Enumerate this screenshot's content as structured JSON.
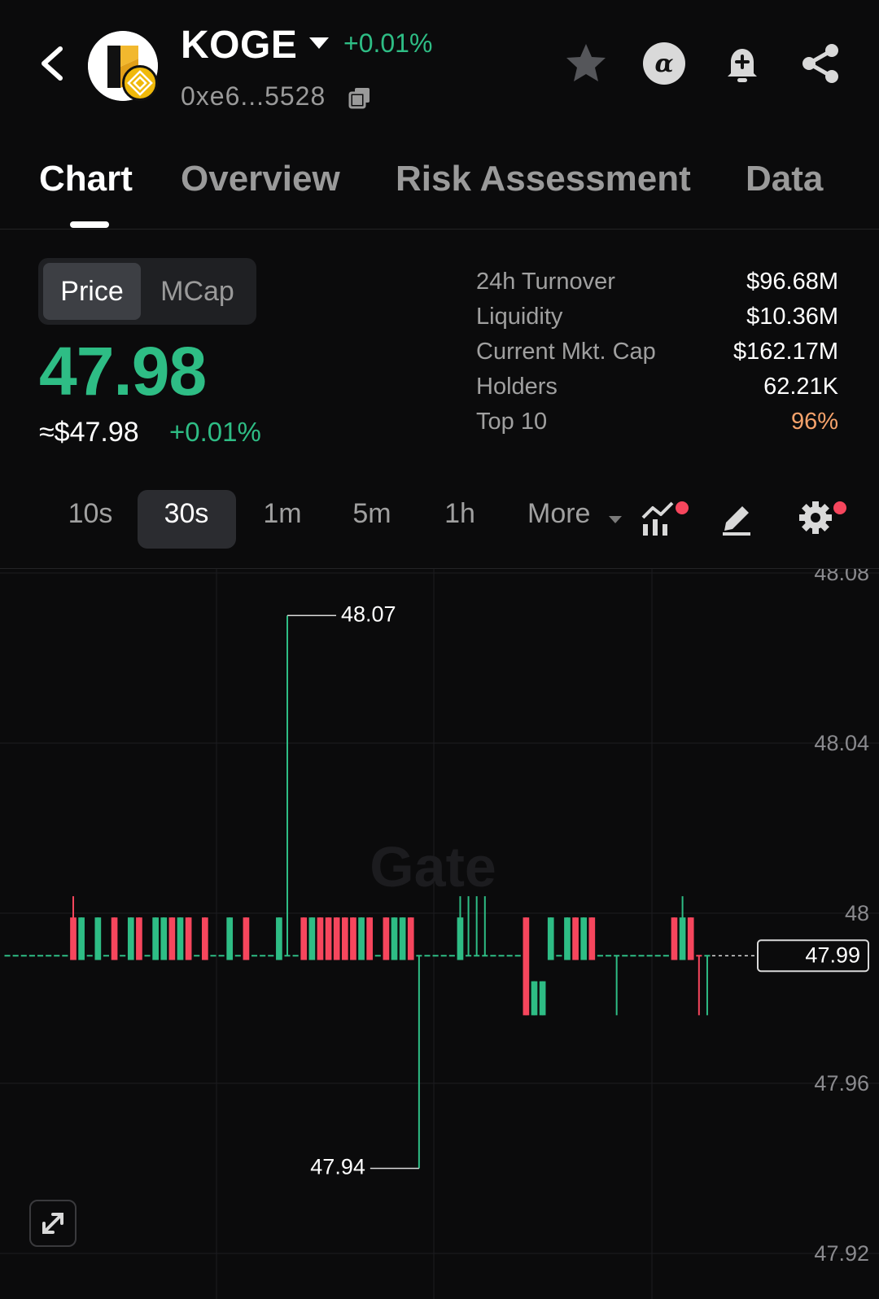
{
  "header": {
    "symbol": "KOGE",
    "change": "+0.01%",
    "address": "0xe6...5528",
    "icons": [
      "back-icon",
      "star-icon",
      "alpha-icon",
      "bell-plus-icon",
      "share-icon",
      "copy-icon"
    ]
  },
  "tabs": [
    {
      "label": "Chart",
      "active": true
    },
    {
      "label": "Overview",
      "active": false
    },
    {
      "label": "Risk Assessment",
      "active": false
    },
    {
      "label": "Data",
      "active": false
    }
  ],
  "price_panel": {
    "toggle": [
      "Price",
      "MCap"
    ],
    "selected_toggle": "Price",
    "price": "47.98",
    "usd_price": "≈$47.98",
    "change": "+0.01%",
    "stats": [
      {
        "label": "24h Turnover",
        "value": "$96.68M"
      },
      {
        "label": "Liquidity",
        "value": "$10.36M"
      },
      {
        "label": "Current Mkt. Cap",
        "value": "$162.17M"
      },
      {
        "label": "Holders",
        "value": "62.21K"
      },
      {
        "label": "Top 10",
        "value": "96%"
      }
    ]
  },
  "intervals": {
    "options": [
      "10s",
      "30s",
      "1m",
      "5m",
      "1h"
    ],
    "selected": "30s",
    "more_label": "More"
  },
  "colors": {
    "up": "#2ebd85",
    "down": "#f6465d",
    "warn": "#f5a26b",
    "background": "#0b0b0c"
  },
  "chart_data": {
    "type": "candlestick",
    "watermark": "Gate",
    "y_ticks": [
      "48.08",
      "48.04",
      "48",
      "47.96",
      "47.92"
    ],
    "ylim": [
      47.92,
      48.08
    ],
    "current_price_label": "47.99",
    "high_label": "48.07",
    "low_label": "47.94",
    "candles": [
      {
        "o": 47.99,
        "h": 47.99,
        "l": 47.99,
        "c": 47.99,
        "d": "up"
      },
      {
        "o": 47.99,
        "h": 47.99,
        "l": 47.99,
        "c": 47.99,
        "d": "up"
      },
      {
        "o": 47.99,
        "h": 47.99,
        "l": 47.99,
        "c": 47.99,
        "d": "up"
      },
      {
        "o": 47.99,
        "h": 47.99,
        "l": 47.99,
        "c": 47.99,
        "d": "up"
      },
      {
        "o": 47.99,
        "h": 47.99,
        "l": 47.99,
        "c": 47.99,
        "d": "up"
      },
      {
        "o": 47.99,
        "h": 47.99,
        "l": 47.99,
        "c": 47.99,
        "d": "up"
      },
      {
        "o": 47.99,
        "h": 47.99,
        "l": 47.99,
        "c": 47.99,
        "d": "up"
      },
      {
        "o": 47.99,
        "h": 47.99,
        "l": 47.99,
        "c": 47.99,
        "d": "up"
      },
      {
        "o": 47.999,
        "h": 48.004,
        "l": 47.989,
        "c": 47.989,
        "d": "down"
      },
      {
        "o": 47.989,
        "h": 47.999,
        "l": 47.989,
        "c": 47.999,
        "d": "up"
      },
      {
        "o": 47.99,
        "h": 47.99,
        "l": 47.99,
        "c": 47.99,
        "d": "up"
      },
      {
        "o": 47.989,
        "h": 47.999,
        "l": 47.989,
        "c": 47.999,
        "d": "up"
      },
      {
        "o": 47.99,
        "h": 47.99,
        "l": 47.99,
        "c": 47.99,
        "d": "up"
      },
      {
        "o": 47.999,
        "h": 47.999,
        "l": 47.989,
        "c": 47.989,
        "d": "down"
      },
      {
        "o": 47.99,
        "h": 47.99,
        "l": 47.99,
        "c": 47.99,
        "d": "up"
      },
      {
        "o": 47.989,
        "h": 47.999,
        "l": 47.989,
        "c": 47.999,
        "d": "up"
      },
      {
        "o": 47.999,
        "h": 47.999,
        "l": 47.989,
        "c": 47.989,
        "d": "down"
      },
      {
        "o": 47.99,
        "h": 47.99,
        "l": 47.99,
        "c": 47.99,
        "d": "up"
      },
      {
        "o": 47.989,
        "h": 47.999,
        "l": 47.989,
        "c": 47.999,
        "d": "up"
      },
      {
        "o": 47.989,
        "h": 47.999,
        "l": 47.989,
        "c": 47.999,
        "d": "up"
      },
      {
        "o": 47.999,
        "h": 47.999,
        "l": 47.989,
        "c": 47.989,
        "d": "down"
      },
      {
        "o": 47.989,
        "h": 47.999,
        "l": 47.989,
        "c": 47.999,
        "d": "up"
      },
      {
        "o": 47.999,
        "h": 47.999,
        "l": 47.989,
        "c": 47.989,
        "d": "down"
      },
      {
        "o": 47.99,
        "h": 47.99,
        "l": 47.99,
        "c": 47.99,
        "d": "up"
      },
      {
        "o": 47.999,
        "h": 47.999,
        "l": 47.989,
        "c": 47.989,
        "d": "down"
      },
      {
        "o": 47.99,
        "h": 47.99,
        "l": 47.99,
        "c": 47.99,
        "d": "up"
      },
      {
        "o": 47.99,
        "h": 47.99,
        "l": 47.99,
        "c": 47.99,
        "d": "up"
      },
      {
        "o": 47.989,
        "h": 47.999,
        "l": 47.989,
        "c": 47.999,
        "d": "up"
      },
      {
        "o": 47.99,
        "h": 47.99,
        "l": 47.99,
        "c": 47.99,
        "d": "up"
      },
      {
        "o": 47.999,
        "h": 47.999,
        "l": 47.989,
        "c": 47.989,
        "d": "down"
      },
      {
        "o": 47.99,
        "h": 47.99,
        "l": 47.99,
        "c": 47.99,
        "d": "up"
      },
      {
        "o": 47.99,
        "h": 47.99,
        "l": 47.99,
        "c": 47.99,
        "d": "up"
      },
      {
        "o": 47.99,
        "h": 47.99,
        "l": 47.99,
        "c": 47.99,
        "d": "up"
      },
      {
        "o": 47.989,
        "h": 47.999,
        "l": 47.989,
        "c": 47.999,
        "d": "up"
      },
      {
        "o": 47.99,
        "h": 48.07,
        "l": 47.99,
        "c": 47.99,
        "d": "up"
      },
      {
        "o": 47.99,
        "h": 47.99,
        "l": 47.99,
        "c": 47.99,
        "d": "up"
      },
      {
        "o": 47.999,
        "h": 47.999,
        "l": 47.989,
        "c": 47.989,
        "d": "down"
      },
      {
        "o": 47.989,
        "h": 47.999,
        "l": 47.989,
        "c": 47.999,
        "d": "up"
      },
      {
        "o": 47.999,
        "h": 47.999,
        "l": 47.989,
        "c": 47.989,
        "d": "down"
      },
      {
        "o": 47.999,
        "h": 47.999,
        "l": 47.989,
        "c": 47.989,
        "d": "down"
      },
      {
        "o": 47.999,
        "h": 47.999,
        "l": 47.989,
        "c": 47.989,
        "d": "down"
      },
      {
        "o": 47.999,
        "h": 47.999,
        "l": 47.989,
        "c": 47.989,
        "d": "down"
      },
      {
        "o": 47.999,
        "h": 47.999,
        "l": 47.989,
        "c": 47.989,
        "d": "down"
      },
      {
        "o": 47.989,
        "h": 47.999,
        "l": 47.989,
        "c": 47.999,
        "d": "up"
      },
      {
        "o": 47.999,
        "h": 47.999,
        "l": 47.989,
        "c": 47.989,
        "d": "down"
      },
      {
        "o": 47.99,
        "h": 47.99,
        "l": 47.99,
        "c": 47.99,
        "d": "up"
      },
      {
        "o": 47.999,
        "h": 47.999,
        "l": 47.989,
        "c": 47.989,
        "d": "down"
      },
      {
        "o": 47.989,
        "h": 47.999,
        "l": 47.989,
        "c": 47.999,
        "d": "up"
      },
      {
        "o": 47.989,
        "h": 47.999,
        "l": 47.989,
        "c": 47.999,
        "d": "up"
      },
      {
        "o": 47.999,
        "h": 47.999,
        "l": 47.989,
        "c": 47.989,
        "d": "down"
      },
      {
        "o": 47.99,
        "h": 47.99,
        "l": 47.94,
        "c": 47.99,
        "d": "up"
      },
      {
        "o": 47.99,
        "h": 47.99,
        "l": 47.99,
        "c": 47.99,
        "d": "up"
      },
      {
        "o": 47.99,
        "h": 47.99,
        "l": 47.99,
        "c": 47.99,
        "d": "up"
      },
      {
        "o": 47.99,
        "h": 47.99,
        "l": 47.99,
        "c": 47.99,
        "d": "up"
      },
      {
        "o": 47.99,
        "h": 47.99,
        "l": 47.99,
        "c": 47.99,
        "d": "up"
      },
      {
        "o": 47.989,
        "h": 48.004,
        "l": 47.989,
        "c": 47.999,
        "d": "up"
      },
      {
        "o": 47.99,
        "h": 48.004,
        "l": 47.99,
        "c": 47.99,
        "d": "up"
      },
      {
        "o": 47.99,
        "h": 48.004,
        "l": 47.99,
        "c": 47.99,
        "d": "up"
      },
      {
        "o": 47.99,
        "h": 48.004,
        "l": 47.99,
        "c": 47.99,
        "d": "up"
      },
      {
        "o": 47.99,
        "h": 47.99,
        "l": 47.99,
        "c": 47.99,
        "d": "up"
      },
      {
        "o": 47.99,
        "h": 47.99,
        "l": 47.99,
        "c": 47.99,
        "d": "up"
      },
      {
        "o": 47.99,
        "h": 47.99,
        "l": 47.99,
        "c": 47.99,
        "d": "up"
      },
      {
        "o": 47.99,
        "h": 47.99,
        "l": 47.99,
        "c": 47.99,
        "d": "up"
      },
      {
        "o": 47.999,
        "h": 47.999,
        "l": 47.976,
        "c": 47.976,
        "d": "down"
      },
      {
        "o": 47.976,
        "h": 47.984,
        "l": 47.976,
        "c": 47.984,
        "d": "up"
      },
      {
        "o": 47.976,
        "h": 47.984,
        "l": 47.976,
        "c": 47.984,
        "d": "up"
      },
      {
        "o": 47.989,
        "h": 47.999,
        "l": 47.989,
        "c": 47.999,
        "d": "up"
      },
      {
        "o": 47.99,
        "h": 47.99,
        "l": 47.99,
        "c": 47.99,
        "d": "up"
      },
      {
        "o": 47.989,
        "h": 47.999,
        "l": 47.989,
        "c": 47.999,
        "d": "up"
      },
      {
        "o": 47.999,
        "h": 47.999,
        "l": 47.989,
        "c": 47.989,
        "d": "down"
      },
      {
        "o": 47.989,
        "h": 47.999,
        "l": 47.989,
        "c": 47.999,
        "d": "up"
      },
      {
        "o": 47.999,
        "h": 47.999,
        "l": 47.989,
        "c": 47.989,
        "d": "down"
      },
      {
        "o": 47.99,
        "h": 47.99,
        "l": 47.99,
        "c": 47.99,
        "d": "up"
      },
      {
        "o": 47.99,
        "h": 47.99,
        "l": 47.99,
        "c": 47.99,
        "d": "up"
      },
      {
        "o": 47.99,
        "h": 47.99,
        "l": 47.976,
        "c": 47.99,
        "d": "up"
      },
      {
        "o": 47.99,
        "h": 47.99,
        "l": 47.99,
        "c": 47.99,
        "d": "up"
      },
      {
        "o": 47.99,
        "h": 47.99,
        "l": 47.99,
        "c": 47.99,
        "d": "up"
      },
      {
        "o": 47.99,
        "h": 47.99,
        "l": 47.99,
        "c": 47.99,
        "d": "up"
      },
      {
        "o": 47.99,
        "h": 47.99,
        "l": 47.99,
        "c": 47.99,
        "d": "up"
      },
      {
        "o": 47.99,
        "h": 47.99,
        "l": 47.99,
        "c": 47.99,
        "d": "up"
      },
      {
        "o": 47.99,
        "h": 47.99,
        "l": 47.99,
        "c": 47.99,
        "d": "up"
      },
      {
        "o": 47.999,
        "h": 47.999,
        "l": 47.989,
        "c": 47.989,
        "d": "down"
      },
      {
        "o": 47.989,
        "h": 48.004,
        "l": 47.989,
        "c": 47.999,
        "d": "up"
      },
      {
        "o": 47.999,
        "h": 47.999,
        "l": 47.989,
        "c": 47.989,
        "d": "down"
      },
      {
        "o": 47.99,
        "h": 47.99,
        "l": 47.976,
        "c": 47.99,
        "d": "down"
      },
      {
        "o": 47.99,
        "h": 47.99,
        "l": 47.976,
        "c": 47.99,
        "d": "up"
      }
    ]
  }
}
